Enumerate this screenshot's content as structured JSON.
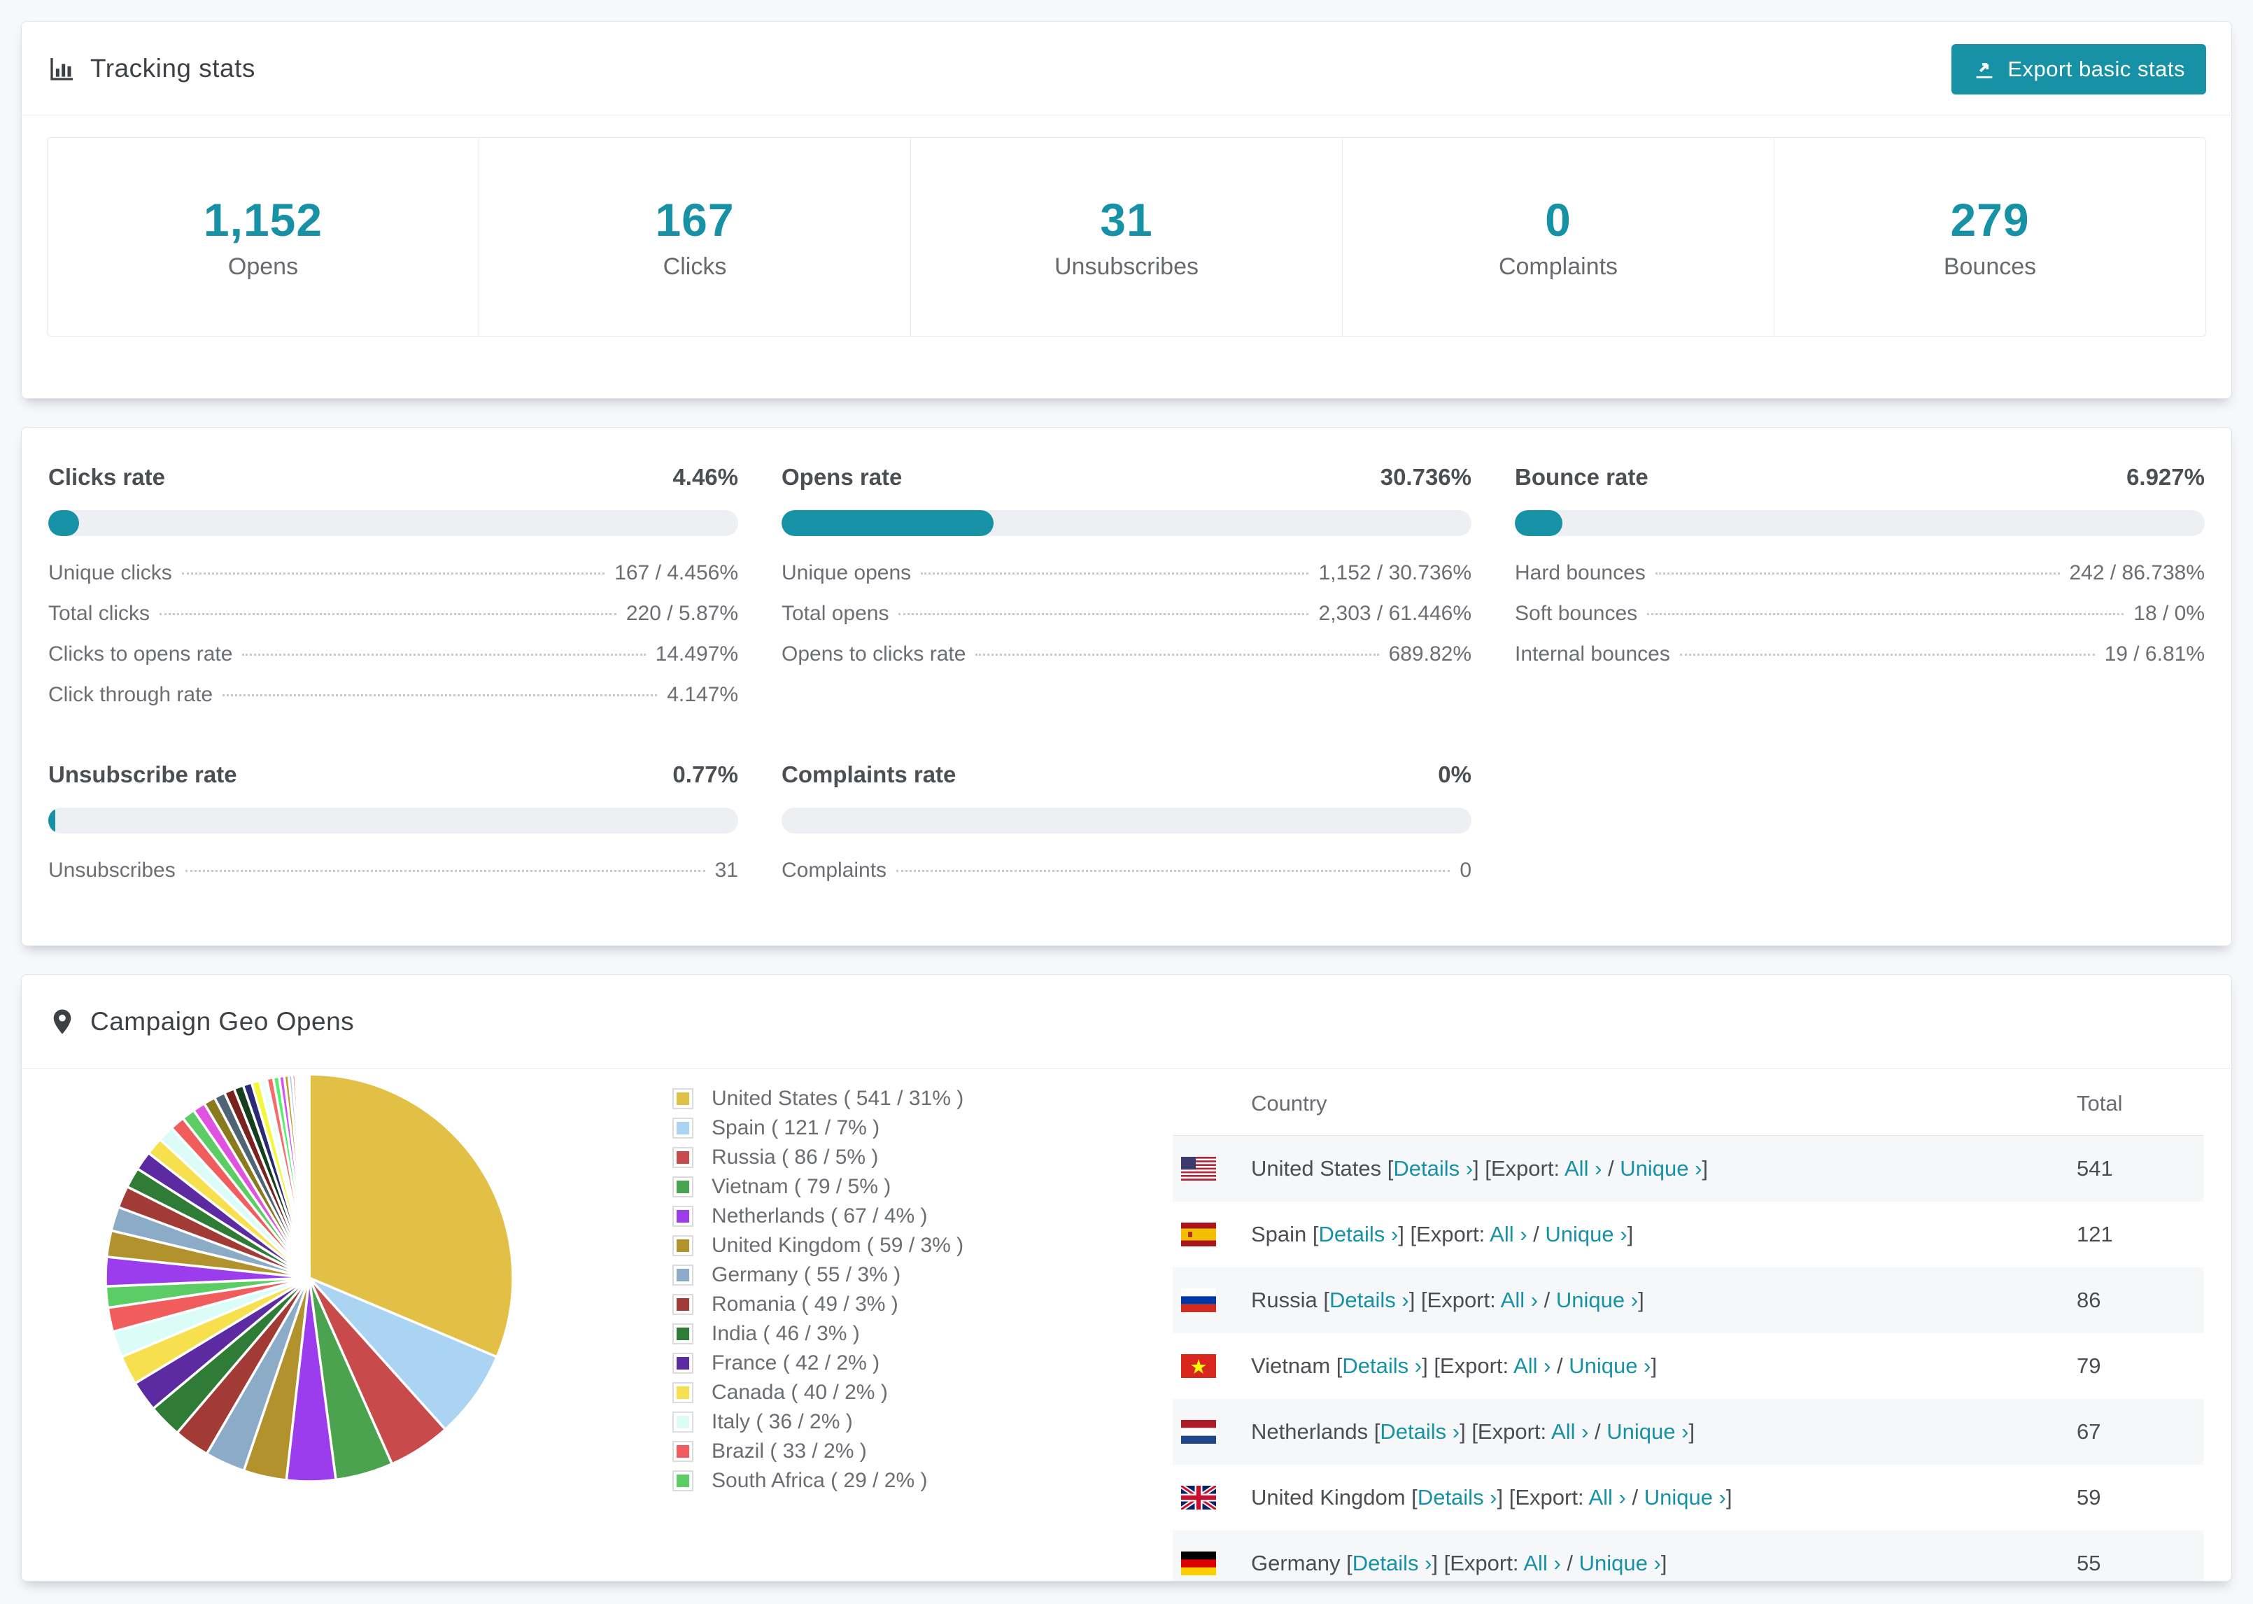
{
  "accent_color": "#1791a5",
  "tracking": {
    "title": "Tracking stats",
    "export_label": "Export basic stats",
    "stats": [
      {
        "value": "1,152",
        "label": "Opens"
      },
      {
        "value": "167",
        "label": "Clicks"
      },
      {
        "value": "31",
        "label": "Unsubscribes"
      },
      {
        "value": "0",
        "label": "Complaints"
      },
      {
        "value": "279",
        "label": "Bounces"
      }
    ]
  },
  "rates": {
    "blocks": [
      {
        "title": "Clicks rate",
        "value": "4.46%",
        "percent": 4.46,
        "rows": [
          {
            "label": "Unique clicks",
            "value": "167 / 4.456%"
          },
          {
            "label": "Total clicks",
            "value": "220 / 5.87%"
          },
          {
            "label": "Clicks to opens rate",
            "value": "14.497%"
          },
          {
            "label": "Click through rate",
            "value": "4.147%"
          }
        ]
      },
      {
        "title": "Opens rate",
        "value": "30.736%",
        "percent": 30.736,
        "rows": [
          {
            "label": "Unique opens",
            "value": "1,152 / 30.736%"
          },
          {
            "label": "Total opens",
            "value": "2,303 / 61.446%"
          },
          {
            "label": "Opens to clicks rate",
            "value": "689.82%"
          }
        ]
      },
      {
        "title": "Bounce rate",
        "value": "6.927%",
        "percent": 6.927,
        "rows": [
          {
            "label": "Hard bounces",
            "value": "242 / 86.738%"
          },
          {
            "label": "Soft bounces",
            "value": "18 / 0%"
          },
          {
            "label": "Internal bounces",
            "value": "19 / 6.81%"
          }
        ]
      },
      {
        "title": "Unsubscribe rate",
        "value": "0.77%",
        "percent": 0.77,
        "rows": [
          {
            "label": "Unsubscribes",
            "value": "31"
          }
        ]
      },
      {
        "title": "Complaints rate",
        "value": "0%",
        "percent": 0,
        "rows": [
          {
            "label": "Complaints",
            "value": "0"
          }
        ]
      }
    ]
  },
  "geo": {
    "title": "Campaign Geo Opens",
    "links": {
      "details_label": "Details ›",
      "export_prefix": "Export:",
      "all_label": "All ›",
      "unique_label": "Unique ›"
    },
    "table": {
      "columns": [
        "Country",
        "Total"
      ],
      "rows": [
        {
          "country": "United States",
          "flag": "us",
          "total": "541"
        },
        {
          "country": "Spain",
          "flag": "es",
          "total": "121"
        },
        {
          "country": "Russia",
          "flag": "ru",
          "total": "86"
        },
        {
          "country": "Vietnam",
          "flag": "vn",
          "total": "79"
        },
        {
          "country": "Netherlands",
          "flag": "nl",
          "total": "67"
        },
        {
          "country": "United Kingdom",
          "flag": "gb",
          "total": "59"
        },
        {
          "country": "Germany",
          "flag": "de",
          "total": "55"
        }
      ]
    }
  },
  "chart_data": {
    "type": "pie",
    "title": "Campaign Geo Opens",
    "legend_position": "right",
    "start_angle_deg": -90,
    "direction": "clockwise",
    "slices": [
      {
        "label": "United States",
        "value": 541,
        "pct": "31%",
        "color": "#e2bf45"
      },
      {
        "label": "Spain",
        "value": 121,
        "pct": "7%",
        "color": "#abd3f2"
      },
      {
        "label": "Russia",
        "value": 86,
        "pct": "5%",
        "color": "#c94a4a"
      },
      {
        "label": "Vietnam",
        "value": 79,
        "pct": "5%",
        "color": "#4ba350"
      },
      {
        "label": "Netherlands",
        "value": 67,
        "pct": "4%",
        "color": "#9b3ced"
      },
      {
        "label": "United Kingdom",
        "value": 59,
        "pct": "3%",
        "color": "#b2922c"
      },
      {
        "label": "Germany",
        "value": 55,
        "pct": "3%",
        "color": "#8cabc6"
      },
      {
        "label": "Romania",
        "value": 49,
        "pct": "3%",
        "color": "#a23a35"
      },
      {
        "label": "India",
        "value": 46,
        "pct": "3%",
        "color": "#2e7c35"
      },
      {
        "label": "France",
        "value": 42,
        "pct": "2%",
        "color": "#5c2ba2"
      },
      {
        "label": "Canada",
        "value": 40,
        "pct": "2%",
        "color": "#f6e04d"
      },
      {
        "label": "Italy",
        "value": 36,
        "pct": "2%",
        "color": "#dcfcf7"
      },
      {
        "label": "Brazil",
        "value": 33,
        "pct": "2%",
        "color": "#f15d5d"
      },
      {
        "label": "South Africa",
        "value": 29,
        "pct": "2%",
        "color": "#5ccc64"
      }
    ],
    "other_slices": [
      40,
      36,
      33,
      30,
      28,
      26,
      24,
      22,
      20,
      18,
      17,
      16,
      15,
      14,
      13,
      12,
      11,
      10,
      9,
      8,
      7,
      6,
      5,
      4,
      3,
      3,
      2,
      2,
      2,
      1,
      1,
      1,
      1,
      1,
      1,
      1
    ],
    "other_palette": [
      "#9b3ced",
      "#b2922c",
      "#8cabc6",
      "#a23a35",
      "#2e7c35",
      "#5c2ba2",
      "#f6e04d",
      "#dcfcf7",
      "#f15d5d",
      "#5ccc64",
      "#e052e0",
      "#8a7a1e",
      "#4f6475",
      "#7a231e",
      "#153f1d",
      "#2d2a75",
      "#f3f73d",
      "#eefffc",
      "#fa6a6a",
      "#52f06a",
      "#d455ee",
      "#c29a2a",
      "#a8cdf0",
      "#d23b3b",
      "#237a2e",
      "#7a3bed",
      "#e8e13d",
      "#f55",
      "#3c9",
      "#c4c",
      "#882",
      "#567",
      "#a33",
      "#262",
      "#338",
      "#ff6"
    ]
  }
}
